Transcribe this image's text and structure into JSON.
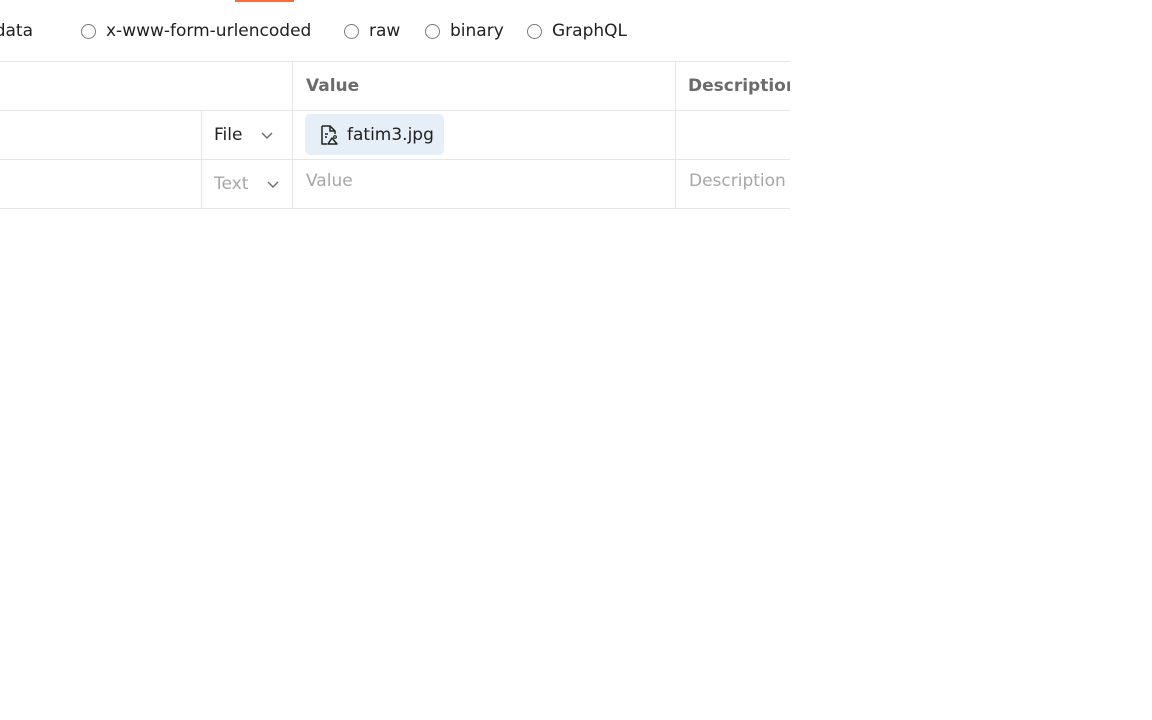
{
  "colors": {
    "accent": "#ff6c37",
    "chip_background": "#e6eef8",
    "border": "#e6e6e6",
    "placeholder": "#a6a6a6"
  },
  "body_types": [
    {
      "label": "form-data",
      "shown_text": "m-data",
      "selected": true
    },
    {
      "label": "x-www-form-urlencoded",
      "selected": false
    },
    {
      "label": "raw",
      "selected": false
    },
    {
      "label": "binary",
      "selected": false
    },
    {
      "label": "GraphQL",
      "selected": false
    }
  ],
  "table": {
    "headers": {
      "value": "Value",
      "description": "Description"
    },
    "rows": [
      {
        "type": "File",
        "value_file_name": "fatim3.jpg",
        "value_icon": "file-image-icon"
      },
      {
        "type": "Text",
        "value_placeholder": "Value",
        "description_placeholder": "Description"
      }
    ]
  }
}
